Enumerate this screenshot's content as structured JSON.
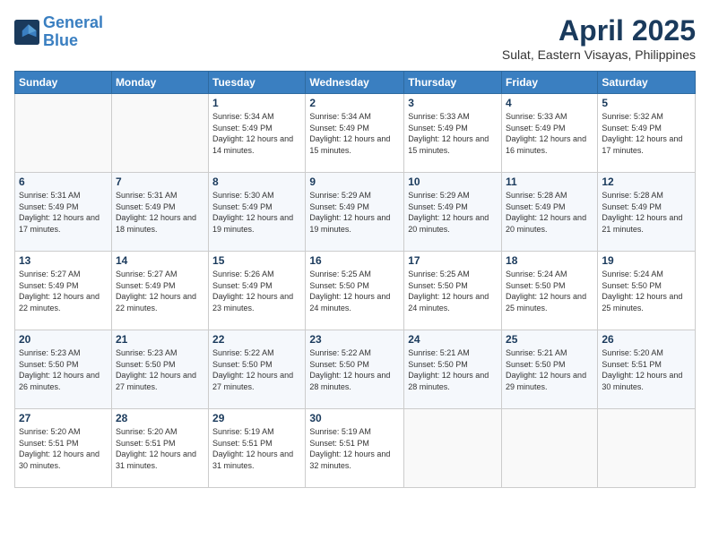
{
  "header": {
    "logo_line1": "General",
    "logo_line2": "Blue",
    "month_title": "April 2025",
    "subtitle": "Sulat, Eastern Visayas, Philippines"
  },
  "days_of_week": [
    "Sunday",
    "Monday",
    "Tuesday",
    "Wednesday",
    "Thursday",
    "Friday",
    "Saturday"
  ],
  "weeks": [
    [
      {
        "day": "",
        "sunrise": "",
        "sunset": "",
        "daylight": ""
      },
      {
        "day": "",
        "sunrise": "",
        "sunset": "",
        "daylight": ""
      },
      {
        "day": "1",
        "sunrise": "Sunrise: 5:34 AM",
        "sunset": "Sunset: 5:49 PM",
        "daylight": "Daylight: 12 hours and 14 minutes."
      },
      {
        "day": "2",
        "sunrise": "Sunrise: 5:34 AM",
        "sunset": "Sunset: 5:49 PM",
        "daylight": "Daylight: 12 hours and 15 minutes."
      },
      {
        "day": "3",
        "sunrise": "Sunrise: 5:33 AM",
        "sunset": "Sunset: 5:49 PM",
        "daylight": "Daylight: 12 hours and 15 minutes."
      },
      {
        "day": "4",
        "sunrise": "Sunrise: 5:33 AM",
        "sunset": "Sunset: 5:49 PM",
        "daylight": "Daylight: 12 hours and 16 minutes."
      },
      {
        "day": "5",
        "sunrise": "Sunrise: 5:32 AM",
        "sunset": "Sunset: 5:49 PM",
        "daylight": "Daylight: 12 hours and 17 minutes."
      }
    ],
    [
      {
        "day": "6",
        "sunrise": "Sunrise: 5:31 AM",
        "sunset": "Sunset: 5:49 PM",
        "daylight": "Daylight: 12 hours and 17 minutes."
      },
      {
        "day": "7",
        "sunrise": "Sunrise: 5:31 AM",
        "sunset": "Sunset: 5:49 PM",
        "daylight": "Daylight: 12 hours and 18 minutes."
      },
      {
        "day": "8",
        "sunrise": "Sunrise: 5:30 AM",
        "sunset": "Sunset: 5:49 PM",
        "daylight": "Daylight: 12 hours and 19 minutes."
      },
      {
        "day": "9",
        "sunrise": "Sunrise: 5:29 AM",
        "sunset": "Sunset: 5:49 PM",
        "daylight": "Daylight: 12 hours and 19 minutes."
      },
      {
        "day": "10",
        "sunrise": "Sunrise: 5:29 AM",
        "sunset": "Sunset: 5:49 PM",
        "daylight": "Daylight: 12 hours and 20 minutes."
      },
      {
        "day": "11",
        "sunrise": "Sunrise: 5:28 AM",
        "sunset": "Sunset: 5:49 PM",
        "daylight": "Daylight: 12 hours and 20 minutes."
      },
      {
        "day": "12",
        "sunrise": "Sunrise: 5:28 AM",
        "sunset": "Sunset: 5:49 PM",
        "daylight": "Daylight: 12 hours and 21 minutes."
      }
    ],
    [
      {
        "day": "13",
        "sunrise": "Sunrise: 5:27 AM",
        "sunset": "Sunset: 5:49 PM",
        "daylight": "Daylight: 12 hours and 22 minutes."
      },
      {
        "day": "14",
        "sunrise": "Sunrise: 5:27 AM",
        "sunset": "Sunset: 5:49 PM",
        "daylight": "Daylight: 12 hours and 22 minutes."
      },
      {
        "day": "15",
        "sunrise": "Sunrise: 5:26 AM",
        "sunset": "Sunset: 5:49 PM",
        "daylight": "Daylight: 12 hours and 23 minutes."
      },
      {
        "day": "16",
        "sunrise": "Sunrise: 5:25 AM",
        "sunset": "Sunset: 5:50 PM",
        "daylight": "Daylight: 12 hours and 24 minutes."
      },
      {
        "day": "17",
        "sunrise": "Sunrise: 5:25 AM",
        "sunset": "Sunset: 5:50 PM",
        "daylight": "Daylight: 12 hours and 24 minutes."
      },
      {
        "day": "18",
        "sunrise": "Sunrise: 5:24 AM",
        "sunset": "Sunset: 5:50 PM",
        "daylight": "Daylight: 12 hours and 25 minutes."
      },
      {
        "day": "19",
        "sunrise": "Sunrise: 5:24 AM",
        "sunset": "Sunset: 5:50 PM",
        "daylight": "Daylight: 12 hours and 25 minutes."
      }
    ],
    [
      {
        "day": "20",
        "sunrise": "Sunrise: 5:23 AM",
        "sunset": "Sunset: 5:50 PM",
        "daylight": "Daylight: 12 hours and 26 minutes."
      },
      {
        "day": "21",
        "sunrise": "Sunrise: 5:23 AM",
        "sunset": "Sunset: 5:50 PM",
        "daylight": "Daylight: 12 hours and 27 minutes."
      },
      {
        "day": "22",
        "sunrise": "Sunrise: 5:22 AM",
        "sunset": "Sunset: 5:50 PM",
        "daylight": "Daylight: 12 hours and 27 minutes."
      },
      {
        "day": "23",
        "sunrise": "Sunrise: 5:22 AM",
        "sunset": "Sunset: 5:50 PM",
        "daylight": "Daylight: 12 hours and 28 minutes."
      },
      {
        "day": "24",
        "sunrise": "Sunrise: 5:21 AM",
        "sunset": "Sunset: 5:50 PM",
        "daylight": "Daylight: 12 hours and 28 minutes."
      },
      {
        "day": "25",
        "sunrise": "Sunrise: 5:21 AM",
        "sunset": "Sunset: 5:50 PM",
        "daylight": "Daylight: 12 hours and 29 minutes."
      },
      {
        "day": "26",
        "sunrise": "Sunrise: 5:20 AM",
        "sunset": "Sunset: 5:51 PM",
        "daylight": "Daylight: 12 hours and 30 minutes."
      }
    ],
    [
      {
        "day": "27",
        "sunrise": "Sunrise: 5:20 AM",
        "sunset": "Sunset: 5:51 PM",
        "daylight": "Daylight: 12 hours and 30 minutes."
      },
      {
        "day": "28",
        "sunrise": "Sunrise: 5:20 AM",
        "sunset": "Sunset: 5:51 PM",
        "daylight": "Daylight: 12 hours and 31 minutes."
      },
      {
        "day": "29",
        "sunrise": "Sunrise: 5:19 AM",
        "sunset": "Sunset: 5:51 PM",
        "daylight": "Daylight: 12 hours and 31 minutes."
      },
      {
        "day": "30",
        "sunrise": "Sunrise: 5:19 AM",
        "sunset": "Sunset: 5:51 PM",
        "daylight": "Daylight: 12 hours and 32 minutes."
      },
      {
        "day": "",
        "sunrise": "",
        "sunset": "",
        "daylight": ""
      },
      {
        "day": "",
        "sunrise": "",
        "sunset": "",
        "daylight": ""
      },
      {
        "day": "",
        "sunrise": "",
        "sunset": "",
        "daylight": ""
      }
    ]
  ]
}
